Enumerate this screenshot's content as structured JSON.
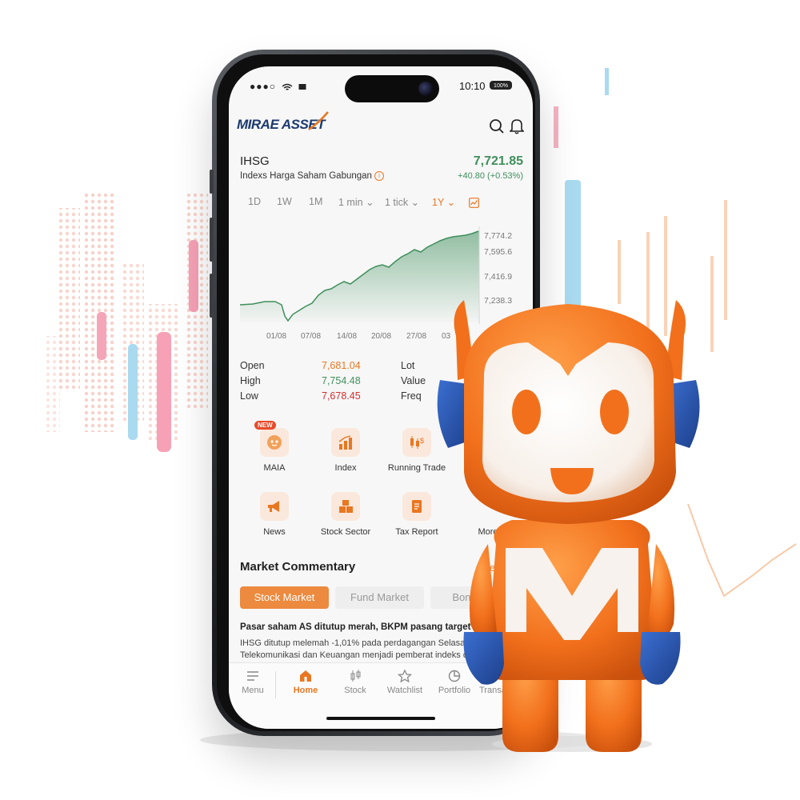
{
  "status_bar": {
    "signal": "●●●○",
    "time": "10:10",
    "battery": "100%"
  },
  "header": {
    "logo": "MIRAE ASSET"
  },
  "index": {
    "code": "IHSG",
    "name": "Indexs Harga Saham Gabungan",
    "price": "7,721.85",
    "change": "+40.80 (+0.53%)"
  },
  "timeframes": [
    "1D",
    "1W",
    "1M",
    "1 min",
    "1 tick",
    "1Y"
  ],
  "chart_data": {
    "type": "area",
    "y_ticks": [
      "7,774.2",
      "7,595.6",
      "7,416.9",
      "7,238.3"
    ],
    "x_ticks": [
      "01/08",
      "07/08",
      "14/08",
      "20/08",
      "27/08",
      "03"
    ],
    "color": "#3f8f5c"
  },
  "stats": {
    "open_label": "Open",
    "open_value": "7,681.04",
    "high_label": "High",
    "high_value": "7,754.48",
    "low_label": "Low",
    "low_value": "7,678.45",
    "lot_label": "Lot",
    "value_label": "Value",
    "freq_label": "Freq"
  },
  "menu": {
    "new_badge": "NEW",
    "items": [
      "MAIA",
      "Index",
      "Running Trade",
      "News",
      "Stock Sector",
      "Tax Report",
      "More"
    ]
  },
  "market_commentary": {
    "title": "Market Commentary",
    "see_all": "See",
    "tabs": [
      "Stock Market",
      "Fund Market",
      "Bond Mar"
    ],
    "news_title": "Pasar saham AS ditutup merah, BKPM pasang target agresif",
    "news_line1": "IHSG ditutup melemah -1,01% pada perdagangan Selasa. Sektor",
    "news_line2": "Telekomunikasi dan Keuangan menjadi pemberat indeks dengan"
  },
  "bottom_nav": [
    "Menu",
    "Home",
    "Stock",
    "Watchlist",
    "Portfolio",
    "Transactio"
  ],
  "colors": {
    "accent": "#e87722",
    "up": "#3f8f5c",
    "down": "#d2312f",
    "brand": "#1c3a6e"
  }
}
